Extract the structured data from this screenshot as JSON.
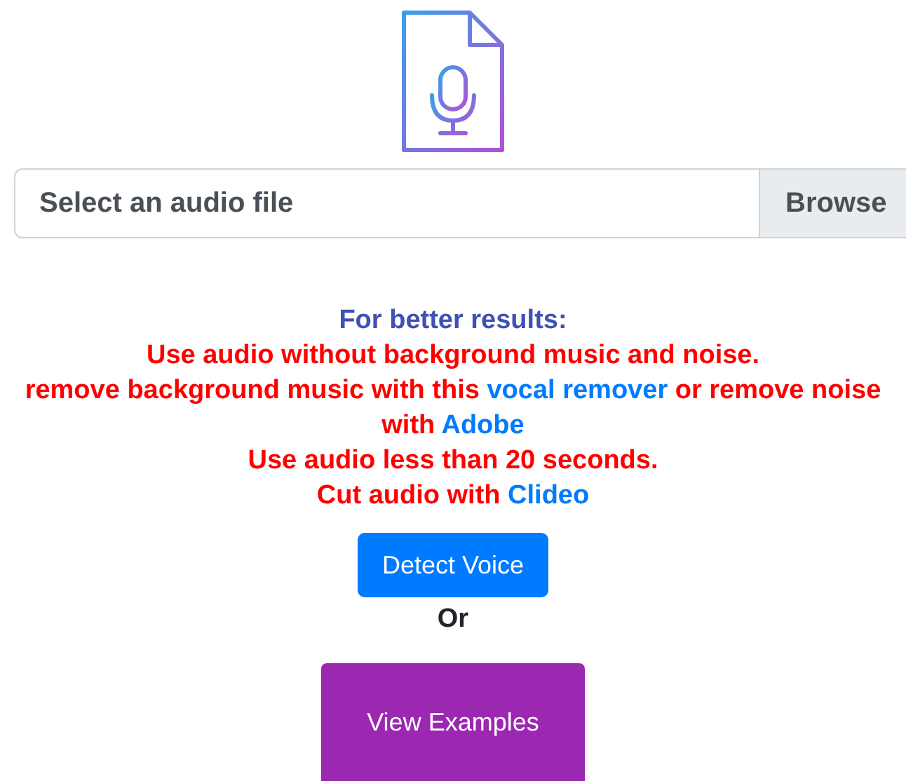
{
  "file_input": {
    "placeholder": "Select an audio file",
    "button": "Browse"
  },
  "tips": {
    "heading": "For better results:",
    "lines": [
      [
        {
          "kind": "text",
          "text": "Use audio without background music and noise."
        }
      ],
      [
        {
          "kind": "text",
          "text": "remove background music with this "
        },
        {
          "kind": "link",
          "text": "vocal remover"
        },
        {
          "kind": "text",
          "text": " or remove noise with "
        },
        {
          "kind": "link",
          "text": "Adobe"
        }
      ],
      [
        {
          "kind": "text",
          "text": "Use audio less than 20 seconds."
        }
      ],
      [
        {
          "kind": "text",
          "text": "Cut audio with "
        },
        {
          "kind": "link",
          "text": "Clideo"
        }
      ]
    ]
  },
  "detect_button": "Detect Voice",
  "separator": "Or",
  "examples_button": "View Examples"
}
